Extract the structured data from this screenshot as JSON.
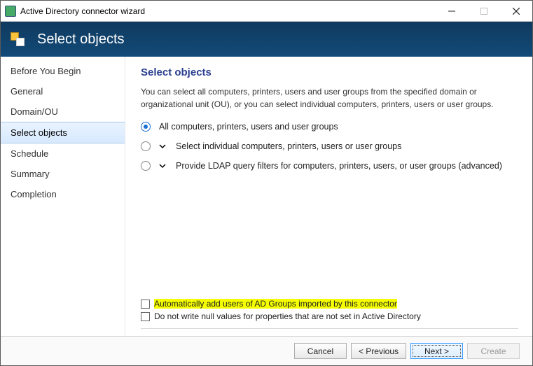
{
  "window": {
    "title": "Active Directory connector wizard"
  },
  "header": {
    "title": "Select objects"
  },
  "sidebar": {
    "items": [
      {
        "label": "Before You Begin"
      },
      {
        "label": "General"
      },
      {
        "label": "Domain/OU"
      },
      {
        "label": "Select objects"
      },
      {
        "label": "Schedule"
      },
      {
        "label": "Summary"
      },
      {
        "label": "Completion"
      }
    ],
    "active_index": 3
  },
  "content": {
    "heading": "Select objects",
    "description": "You can select all computers, printers, users and user groups from the specified domain or organizational unit (OU), or you can select individual computers, printers, users or user groups.",
    "radio_options": [
      {
        "label": "All computers, printers, users and user groups",
        "selected": true,
        "expandable": false
      },
      {
        "label": "Select individual computers, printers, users or user groups",
        "selected": false,
        "expandable": true
      },
      {
        "label": "Provide LDAP query filters for computers, printers, users, or user groups (advanced)",
        "selected": false,
        "expandable": true
      }
    ],
    "checkboxes": [
      {
        "label": "Automatically add users of AD Groups imported by this connector",
        "checked": false,
        "highlighted": true
      },
      {
        "label": "Do not write null values for properties that are not set in Active Directory",
        "checked": false,
        "highlighted": false
      }
    ]
  },
  "footer": {
    "cancel": "Cancel",
    "previous": "< Previous",
    "next": "Next >",
    "create": "Create"
  }
}
